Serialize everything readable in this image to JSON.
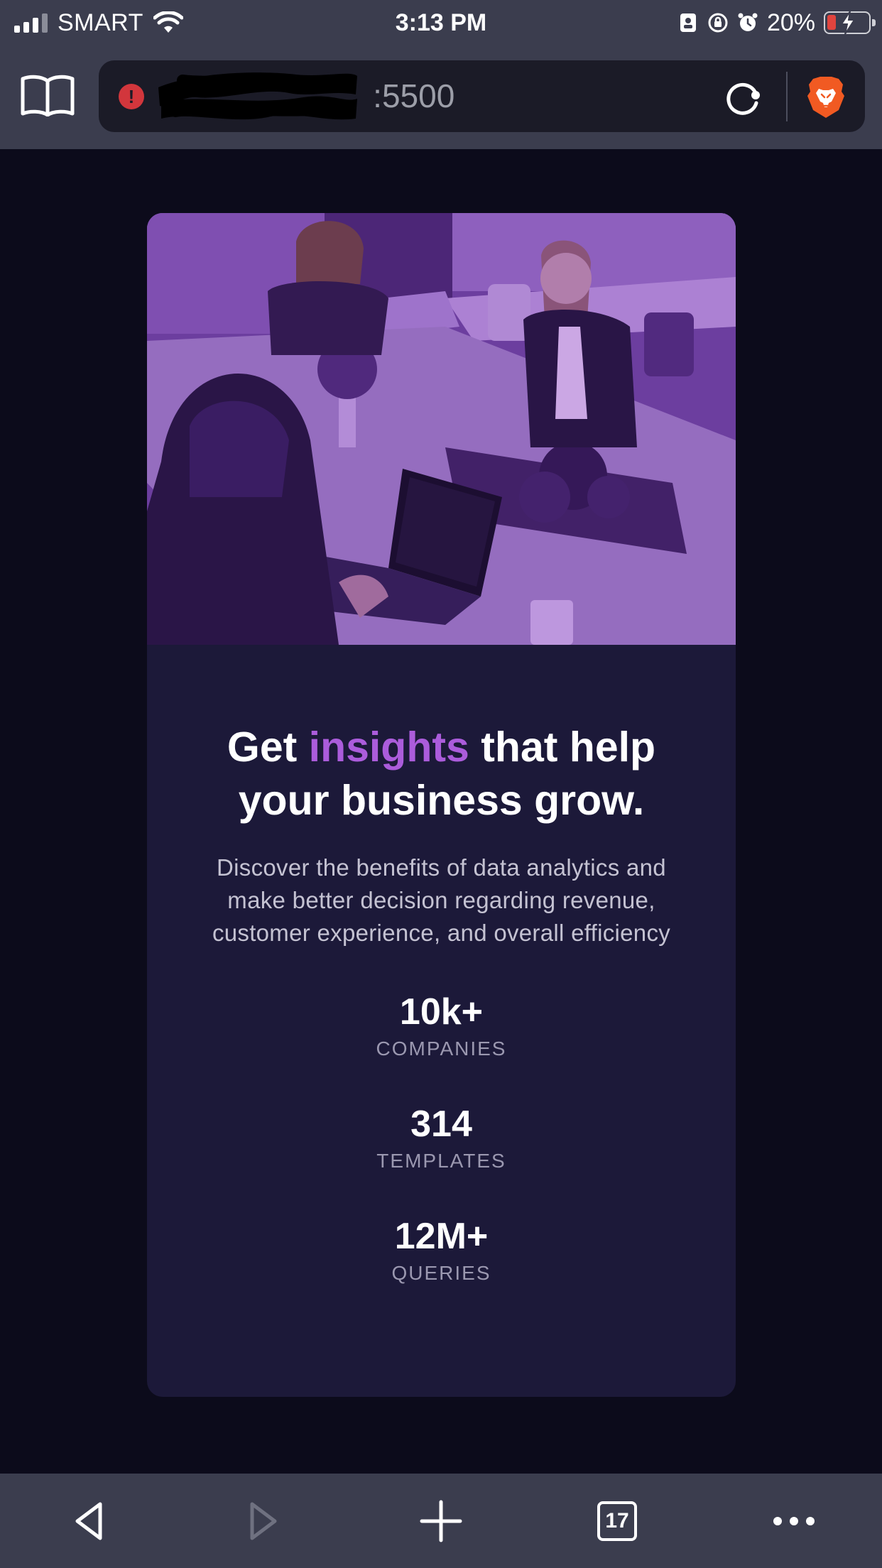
{
  "status_bar": {
    "carrier": "SMART",
    "time": "3:13 PM",
    "battery_percent": "20%",
    "battery_level": 0.2
  },
  "browser": {
    "url_visible_suffix": ":5500",
    "tab_count": "17",
    "colors": {
      "bar": "#3b3d4e",
      "url_field": "#1b1b27",
      "warning": "#d2363c",
      "brave": "#f15a22"
    }
  },
  "card": {
    "headline": {
      "before": "Get ",
      "accent": "insights",
      "after": " that help your business grow."
    },
    "description": "Discover the benefits of data analytics and make better decision regarding revenue, customer experience, and overall efficiency",
    "stats": [
      {
        "value": "10k+",
        "label": "COMPANIES"
      },
      {
        "value": "314",
        "label": "TEMPLATES"
      },
      {
        "value": "12M+",
        "label": "QUERIES"
      }
    ],
    "colors": {
      "background": "#1c1939",
      "accent": "#ab5cdb",
      "page": "#0c0b1b"
    }
  }
}
